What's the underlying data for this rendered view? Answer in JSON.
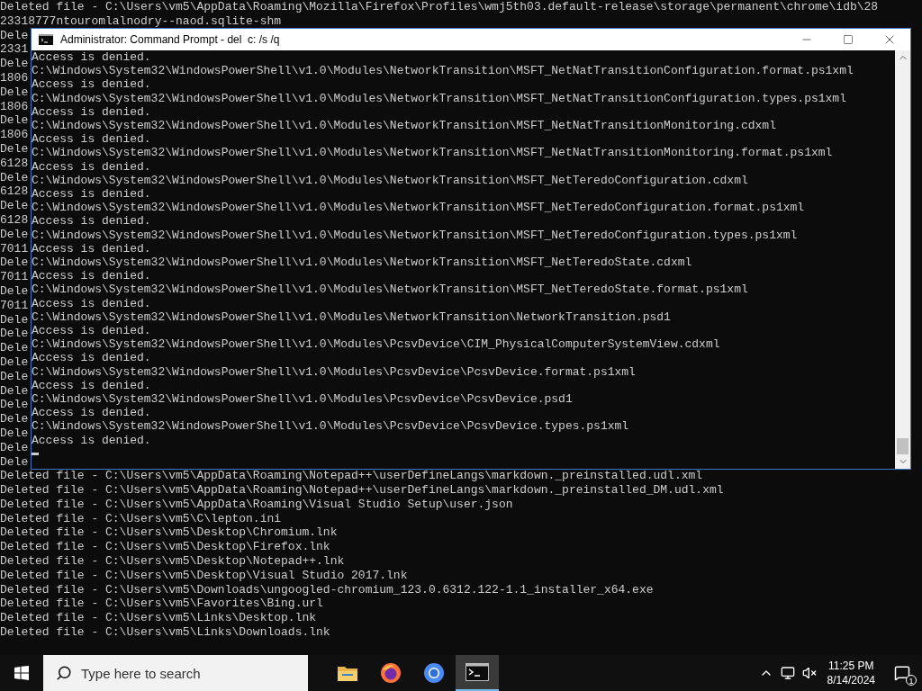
{
  "background_console": {
    "lines": [
      "Deleted file - C:\\Users\\vm5\\AppData\\Roaming\\Mozilla\\Firefox\\Profiles\\wmj5th03.default-release\\storage\\permanent\\chrome\\idb\\28",
      "23318777ntouromlalnodry--naod.sqlite-shm",
      "Dele",
      "2331",
      "Dele",
      "1806",
      "Dele",
      "1806",
      "Dele",
      "1806",
      "Dele",
      "6128",
      "Dele",
      "6128",
      "Dele",
      "6128",
      "Dele",
      "7011",
      "Dele",
      "7011",
      "Dele",
      "7011",
      "Dele",
      "Dele",
      "Dele",
      "Dele",
      "Dele",
      "Dele",
      "Dele",
      "Dele",
      "Dele",
      "Dele",
      "Dele",
      "Deleted file - C:\\Users\\vm5\\AppData\\Roaming\\Notepad++\\userDefineLangs\\markdown._preinstalled.udl.xml",
      "Deleted file - C:\\Users\\vm5\\AppData\\Roaming\\Notepad++\\userDefineLangs\\markdown._preinstalled_DM.udl.xml",
      "Deleted file - C:\\Users\\vm5\\AppData\\Roaming\\Visual Studio Setup\\user.json",
      "Deleted file - C:\\Users\\vm5\\C\\lepton.ini",
      "Deleted file - C:\\Users\\vm5\\Desktop\\Chromium.lnk",
      "Deleted file - C:\\Users\\vm5\\Desktop\\Firefox.lnk",
      "Deleted file - C:\\Users\\vm5\\Desktop\\Notepad++.lnk",
      "Deleted file - C:\\Users\\vm5\\Desktop\\Visual Studio 2017.lnk",
      "Deleted file - C:\\Users\\vm5\\Downloads\\ungoogled-chromium_123.0.6312.122-1.1_installer_x64.exe",
      "Deleted file - C:\\Users\\vm5\\Favorites\\Bing.url",
      "Deleted file - C:\\Users\\vm5\\Links\\Desktop.lnk",
      "Deleted file - C:\\Users\\vm5\\Links\\Downloads.lnk"
    ]
  },
  "window": {
    "title": "Administrator: Command Prompt - del  c: /s /q",
    "lines": [
      "Access is denied.",
      "C:\\Windows\\System32\\WindowsPowerShell\\v1.0\\Modules\\NetworkTransition\\MSFT_NetNatTransitionConfiguration.format.ps1xml",
      "Access is denied.",
      "C:\\Windows\\System32\\WindowsPowerShell\\v1.0\\Modules\\NetworkTransition\\MSFT_NetNatTransitionConfiguration.types.ps1xml",
      "Access is denied.",
      "C:\\Windows\\System32\\WindowsPowerShell\\v1.0\\Modules\\NetworkTransition\\MSFT_NetNatTransitionMonitoring.cdxml",
      "Access is denied.",
      "C:\\Windows\\System32\\WindowsPowerShell\\v1.0\\Modules\\NetworkTransition\\MSFT_NetNatTransitionMonitoring.format.ps1xml",
      "Access is denied.",
      "C:\\Windows\\System32\\WindowsPowerShell\\v1.0\\Modules\\NetworkTransition\\MSFT_NetTeredoConfiguration.cdxml",
      "Access is denied.",
      "C:\\Windows\\System32\\WindowsPowerShell\\v1.0\\Modules\\NetworkTransition\\MSFT_NetTeredoConfiguration.format.ps1xml",
      "Access is denied.",
      "C:\\Windows\\System32\\WindowsPowerShell\\v1.0\\Modules\\NetworkTransition\\MSFT_NetTeredoConfiguration.types.ps1xml",
      "Access is denied.",
      "C:\\Windows\\System32\\WindowsPowerShell\\v1.0\\Modules\\NetworkTransition\\MSFT_NetTeredoState.cdxml",
      "Access is denied.",
      "C:\\Windows\\System32\\WindowsPowerShell\\v1.0\\Modules\\NetworkTransition\\MSFT_NetTeredoState.format.ps1xml",
      "Access is denied.",
      "C:\\Windows\\System32\\WindowsPowerShell\\v1.0\\Modules\\NetworkTransition\\NetworkTransition.psd1",
      "Access is denied.",
      "C:\\Windows\\System32\\WindowsPowerShell\\v1.0\\Modules\\PcsvDevice\\CIM_PhysicalComputerSystemView.cdxml",
      "Access is denied.",
      "C:\\Windows\\System32\\WindowsPowerShell\\v1.0\\Modules\\PcsvDevice\\PcsvDevice.format.ps1xml",
      "Access is denied.",
      "C:\\Windows\\System32\\WindowsPowerShell\\v1.0\\Modules\\PcsvDevice\\PcsvDevice.psd1",
      "Access is denied.",
      "C:\\Windows\\System32\\WindowsPowerShell\\v1.0\\Modules\\PcsvDevice\\PcsvDevice.types.ps1xml",
      "Access is denied."
    ]
  },
  "taskbar": {
    "search": {
      "placeholder": "Type here to search"
    },
    "apps": [
      {
        "kind": "folder",
        "selected": false
      },
      {
        "kind": "firefox",
        "selected": false
      },
      {
        "kind": "chromium",
        "selected": false
      },
      {
        "kind": "terminal",
        "selected": true
      }
    ],
    "time": "11:25 PM",
    "date": "8/14/2024",
    "notification_count": "1"
  }
}
